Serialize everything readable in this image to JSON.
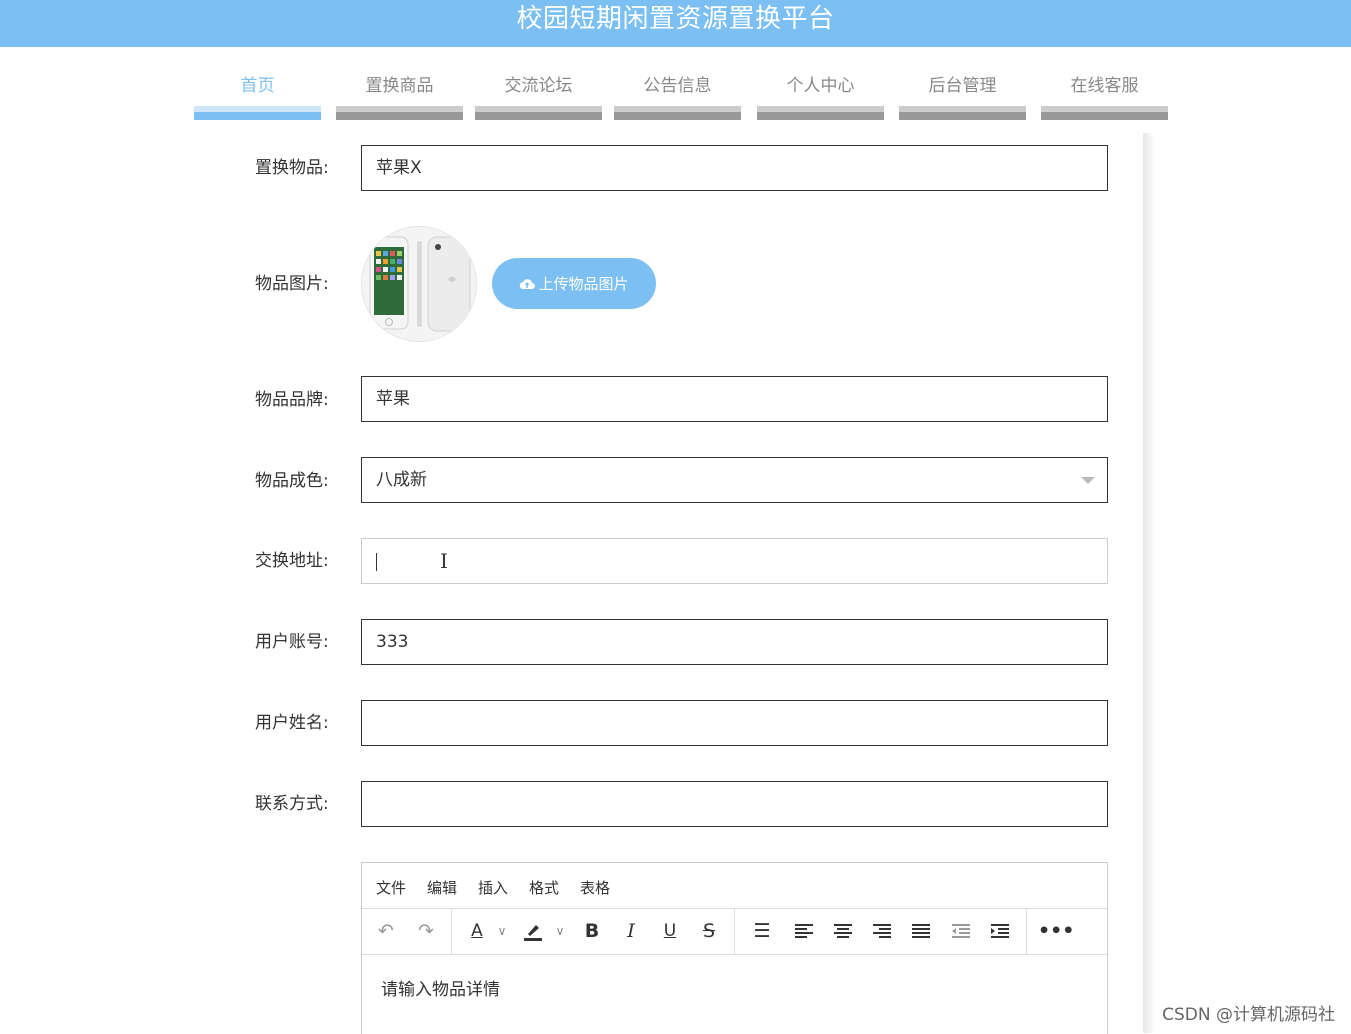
{
  "header": {
    "title": "校园短期闲置资源置换平台"
  },
  "nav": {
    "items": [
      {
        "label": "首页",
        "active": true
      },
      {
        "label": "置换商品"
      },
      {
        "label": "交流论坛"
      },
      {
        "label": "公告信息"
      },
      {
        "label": "个人中心"
      },
      {
        "label": "后台管理"
      },
      {
        "label": "在线客服"
      }
    ]
  },
  "form": {
    "item_name": {
      "label": "置换物品:",
      "value": "苹果X"
    },
    "item_image": {
      "label": "物品图片:",
      "upload_label": "上传物品图片",
      "upload_icon": "cloud-upload-icon"
    },
    "brand": {
      "label": "物品品牌:",
      "value": "苹果"
    },
    "condition": {
      "label": "物品成色:",
      "value": "八成新"
    },
    "address": {
      "label": "交换地址:",
      "value": ""
    },
    "account": {
      "label": "用户账号:",
      "value": "333"
    },
    "username": {
      "label": "用户姓名:",
      "value": ""
    },
    "contact": {
      "label": "联系方式:",
      "value": ""
    }
  },
  "editor": {
    "menu": [
      "文件",
      "编辑",
      "插入",
      "格式",
      "表格"
    ],
    "placeholder": "请输入物品详情",
    "tools": [
      "undo-icon",
      "redo-icon",
      "font-color-icon",
      "highlight-icon",
      "bold-icon",
      "italic-icon",
      "underline-icon",
      "strikethrough-icon",
      "line-height-icon",
      "align-left-icon",
      "align-center-icon",
      "align-right-icon",
      "align-justify-icon",
      "outdent-icon",
      "indent-icon",
      "more-icon"
    ]
  },
  "watermark": "CSDN @计算机源码社",
  "colors": {
    "primary": "#7cbff3",
    "nav_inactive": "#999999"
  }
}
